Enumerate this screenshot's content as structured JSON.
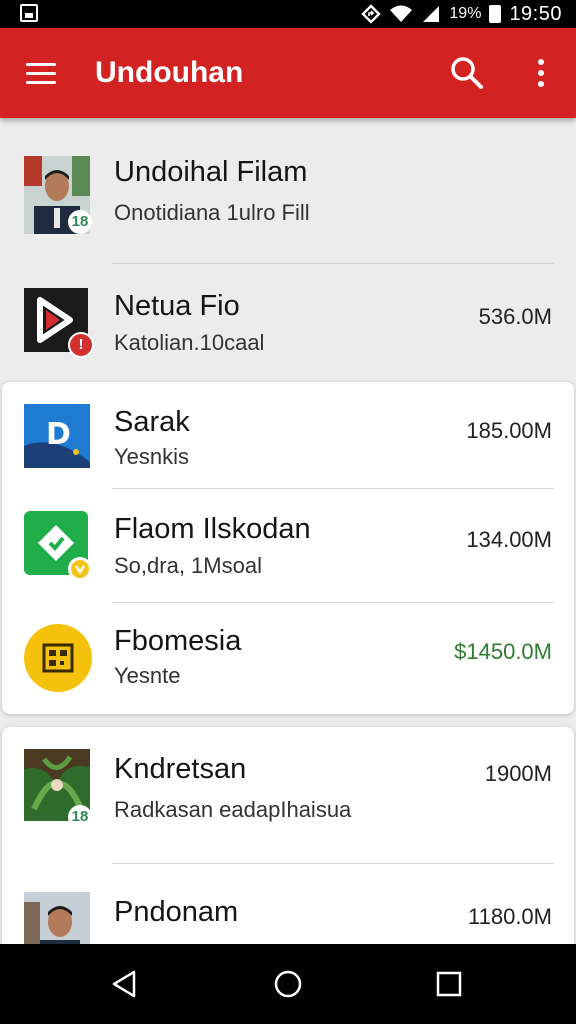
{
  "status_bar": {
    "battery": "19%",
    "time": "19:50"
  },
  "app_bar": {
    "title": "Undouhan",
    "background": "#d32222"
  },
  "downloads": [
    {
      "title": "Undoihal Filam",
      "subtitle": "Onotidiana 1ulro Fill",
      "size": "",
      "badge": "18",
      "thumb": "person-photo"
    },
    {
      "title": "Netua Fio",
      "subtitle": "Katolian.10caal",
      "size": "536.0M",
      "badge": "",
      "thumb": "video-player-logo"
    },
    {
      "title": "Sarak",
      "subtitle": "Yesnkis",
      "size": "185.00M",
      "badge": "",
      "thumb": "blue-d-logo"
    },
    {
      "title": "Flaom Ilskodan",
      "subtitle": "So,dra, 1Msoal",
      "size": "134.00M",
      "badge": "",
      "thumb": "green-app-logo"
    },
    {
      "title": "Fbomesia",
      "subtitle": "Yesnte",
      "size": "$1450.0M",
      "badge": "",
      "thumb": "qr-logo"
    },
    {
      "title": "Kndretsan",
      "subtitle": "Radkasan eadapIhaisua",
      "size": "1900M",
      "badge": "18",
      "thumb": "plant-photo"
    },
    {
      "title": "Pndonam",
      "subtitle": "",
      "size": "1180.0M",
      "badge": "",
      "thumb": "person-photo"
    }
  ],
  "nav_bar": {
    "back_label": "back",
    "home_label": "home",
    "recents_label": "recents"
  }
}
